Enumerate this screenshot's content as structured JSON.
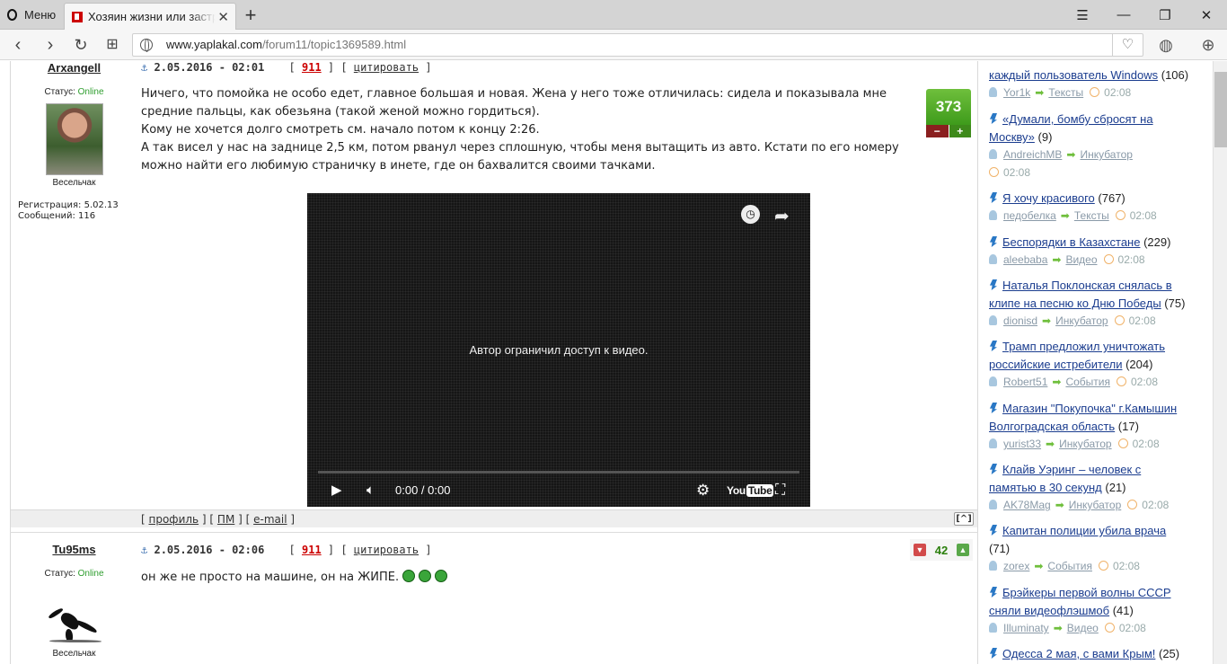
{
  "browser": {
    "menu_label": "Меню",
    "tab_title": "Хозяин жизни или застрял",
    "url_host": "www.yaplakal.com",
    "url_path": "/forum11/topic1369589.html"
  },
  "posts": [
    {
      "author": "Arxangell",
      "status_label": "Статус:",
      "status_value": "Online",
      "rank": "Весельчак",
      "registration": "Регистрация: 5.02.13",
      "messages": "Сообщений: 116",
      "date": "2.05.2016 - 02:01",
      "count": "911",
      "quote_label": "цитировать",
      "text": [
        "Ничего, что помойка не особо едет, главное большая и новая. Жена у него тоже отличилась: сидела и показывала мне",
        "средние пальцы, как обезьяна (такой женой можно гордиться).",
        "Кому не хочется долго смотреть см. начало потом к концу 2:26.",
        "А так висел у нас на заднице 2,5 км, потом рванул через сплошную, чтобы меня вытащить из авто. Кстати по его номеру",
        "можно найти его любимую страничку в инете, где он бахвалится своими тачками."
      ],
      "rating": "373",
      "video": {
        "message": "Автор ограничил доступ к видео.",
        "time": "0:00 / 0:00",
        "brand": "You",
        "brand_box": "Tube"
      },
      "footer": {
        "profile": "профиль",
        "pm": "ПМ",
        "email": "e-mail",
        "top": "^"
      }
    },
    {
      "author": "Tu95ms",
      "status_label": "Статус:",
      "status_value": "Online",
      "rank": "Весельчак",
      "date": "2.05.2016 - 02:06",
      "count": "911",
      "quote_label": "цитировать",
      "text": "он же не просто на машине, он на ЖИПЕ.",
      "karma": "42"
    }
  ],
  "sidebar": [
    {
      "line1": "каждый пользователь Windows",
      "count": "(106)",
      "user": "Yor1k",
      "cat": "Тексты",
      "time": "02:08"
    },
    {
      "line1": "«Думали, бомбу сбросят на",
      "line2": "Москву»",
      "count": "(9)",
      "user": "AndreichMB",
      "cat": "Инкубатор",
      "time": "02:08"
    },
    {
      "line1": "Я хочу красивого",
      "count": "(767)",
      "user": "педобелка",
      "cat": "Тексты",
      "time": "02:08"
    },
    {
      "line1": "Беспорядки в Казахстане",
      "count": "(229)",
      "user": "aleebaba",
      "cat": "Видео",
      "time": "02:08"
    },
    {
      "line1": "Наталья Поклонская снялась в",
      "line2": "клипе на песню ко Дню Победы",
      "count": "(75)",
      "user": "dionisd",
      "cat": "Инкубатор",
      "time": "02:08"
    },
    {
      "line1": "Трамп предложил уничтожать",
      "line2": "российские истребители",
      "count": "(204)",
      "user": "Robert51",
      "cat": "События",
      "time": "02:08"
    },
    {
      "line1": "Магазин \"Покупочка\" г.Камышин",
      "line2": "Волгоградская область",
      "count": "(17)",
      "user": "yurist33",
      "cat": "Инкубатор",
      "time": "02:08"
    },
    {
      "line1": "Клайв Уэринг – человек с",
      "line2": "памятью в 30 секунд",
      "count": "(21)",
      "user": "AK78Mag",
      "cat": "Инкубатор",
      "time": "02:08"
    },
    {
      "line1": "Капитан полиции убила врача",
      "count": "(71)",
      "user": "zorex",
      "cat": "События",
      "time": "02:08"
    },
    {
      "line1": "Брэйкеры первой волны СССР",
      "line2": "сняли видеофлэшмоб",
      "count": "(41)",
      "user": "Illuminaty",
      "cat": "Видео",
      "time": "02:08"
    },
    {
      "line1": "Одесса 2 мая, с вами Крым!",
      "count": "(25)"
    }
  ]
}
